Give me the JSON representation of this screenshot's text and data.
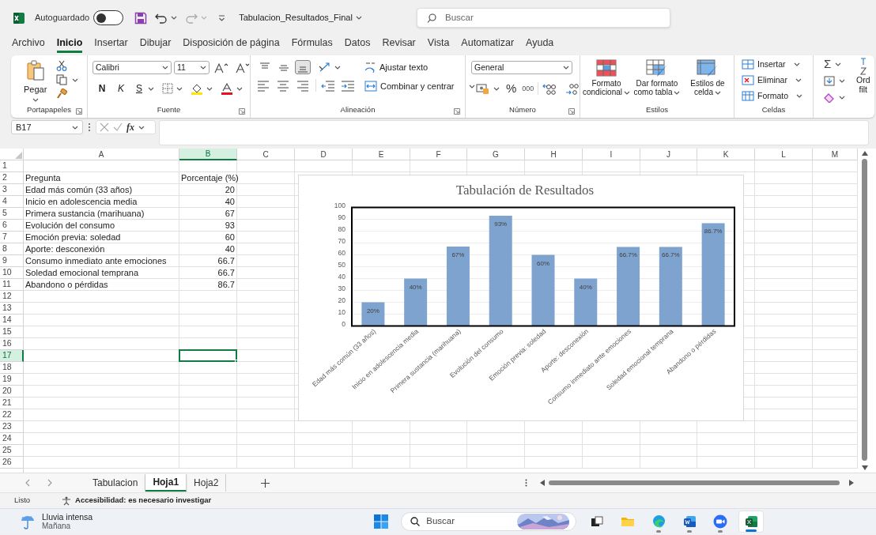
{
  "title_bar": {
    "autosave_label": "Autoguardado",
    "autosave_on": false,
    "file_name": "Tabulacion_Resultados_Final",
    "search_placeholder": "Buscar"
  },
  "menu_tabs": [
    {
      "label": "Archivo",
      "selected": false
    },
    {
      "label": "Inicio",
      "selected": true
    },
    {
      "label": "Insertar",
      "selected": false
    },
    {
      "label": "Dibujar",
      "selected": false
    },
    {
      "label": "Disposición de página",
      "selected": false
    },
    {
      "label": "Fórmulas",
      "selected": false
    },
    {
      "label": "Datos",
      "selected": false
    },
    {
      "label": "Revisar",
      "selected": false
    },
    {
      "label": "Vista",
      "selected": false
    },
    {
      "label": "Automatizar",
      "selected": false
    },
    {
      "label": "Ayuda",
      "selected": false
    }
  ],
  "ribbon": {
    "clipboard": {
      "paste_label": "Pegar",
      "group_label": "Portapapeles"
    },
    "font": {
      "font_name": "Calibri",
      "font_size": "11",
      "bold_label": "N",
      "italic_label": "K",
      "underline_label": "S",
      "group_label": "Fuente"
    },
    "alignment": {
      "vertical_align": [
        {
          "kind": "top",
          "selected": false
        },
        {
          "kind": "middle",
          "selected": false
        },
        {
          "kind": "bottom",
          "selected": true
        }
      ],
      "wrap_label": "Ajustar texto",
      "merge_label": "Combinar y centrar",
      "group_label": "Alineación"
    },
    "number": {
      "format": "General",
      "percent_label": "%",
      "thousands_label": "000",
      "group_label": "Número"
    },
    "styles": {
      "buttons": [
        {
          "kind": "conditional",
          "label": "Formato condicional"
        },
        {
          "kind": "table",
          "label": "Dar formato como tabla"
        },
        {
          "kind": "cell",
          "label": "Estilos de celda"
        }
      ],
      "group_label": "Estilos"
    },
    "cells": {
      "buttons": [
        {
          "kind": "insert",
          "label": "Insertar"
        },
        {
          "kind": "delete",
          "label": "Eliminar"
        },
        {
          "kind": "format",
          "label": "Formato"
        }
      ],
      "group_label": "Celdas"
    },
    "editing": {
      "sum_symbol": "Σ",
      "sort_label_lines": [
        "Ord",
        "filt"
      ]
    }
  },
  "formula_bar": {
    "name_box": "B17",
    "function_label": "fx"
  },
  "sheet": {
    "columns": [
      {
        "label": "A",
        "selected": false
      },
      {
        "label": "B",
        "selected": true
      },
      {
        "label": "C",
        "selected": false
      },
      {
        "label": "D",
        "selected": false
      },
      {
        "label": "E",
        "selected": false
      },
      {
        "label": "F",
        "selected": false
      },
      {
        "label": "G",
        "selected": false
      },
      {
        "label": "H",
        "selected": false
      },
      {
        "label": "I",
        "selected": false
      },
      {
        "label": "J",
        "selected": false
      },
      {
        "label": "K",
        "selected": false
      },
      {
        "label": "L",
        "selected": false
      },
      {
        "label": "M",
        "selected": false
      }
    ],
    "rows": [
      {
        "label": "1",
        "selected": false
      },
      {
        "label": "2",
        "selected": false,
        "kind": "header",
        "a": "Pregunta",
        "b": "Porcentaje (%)"
      },
      {
        "label": "3",
        "selected": false,
        "kind": "data",
        "a": "Edad más común (33 años)",
        "b": "20"
      },
      {
        "label": "4",
        "selected": false,
        "kind": "data",
        "a": "Inicio en adolescencia media",
        "b": "40"
      },
      {
        "label": "5",
        "selected": false,
        "kind": "data",
        "a": "Primera sustancia (marihuana)",
        "b": "67"
      },
      {
        "label": "6",
        "selected": false,
        "kind": "data",
        "a": "Evolución del consumo",
        "b": "93"
      },
      {
        "label": "7",
        "selected": false,
        "kind": "data",
        "a": "Emoción previa: soledad",
        "b": "60"
      },
      {
        "label": "8",
        "selected": false,
        "kind": "data",
        "a": "Aporte: desconexión",
        "b": "40"
      },
      {
        "label": "9",
        "selected": false,
        "kind": "data",
        "a": "Consumo inmediato ante emociones",
        "b": "66.7"
      },
      {
        "label": "10",
        "selected": false,
        "kind": "data",
        "a": "Soledad emocional temprana",
        "b": "66.7"
      },
      {
        "label": "11",
        "selected": false,
        "kind": "data",
        "a": "Abandono o pérdidas",
        "b": "86.7"
      },
      {
        "label": "12",
        "selected": false
      },
      {
        "label": "13",
        "selected": false
      },
      {
        "label": "14",
        "selected": false
      },
      {
        "label": "15",
        "selected": false
      },
      {
        "label": "16",
        "selected": false
      },
      {
        "label": "17",
        "selected": true
      },
      {
        "label": "18",
        "selected": false
      },
      {
        "label": "19",
        "selected": false
      },
      {
        "label": "20",
        "selected": false
      },
      {
        "label": "21",
        "selected": false
      },
      {
        "label": "22",
        "selected": false
      },
      {
        "label": "23",
        "selected": false
      },
      {
        "label": "24",
        "selected": false
      },
      {
        "label": "25",
        "selected": false
      },
      {
        "label": "26",
        "selected": false
      }
    ],
    "chart_data": {
      "type": "bar",
      "title": "Tabulación de Resultados",
      "categories": [
        "Edad más común (33 años)",
        "Inicio en adolescencia media",
        "Primera sustancia (marihuana)",
        "Evolución del consumo",
        "Emoción previa: soledad",
        "Aporte: desconexión",
        "Consumo inmediato ante emociones",
        "Soledad emocional temprana",
        "Abandono o pérdidas"
      ],
      "values": [
        20,
        40,
        67,
        93,
        60,
        40,
        66.7,
        66.7,
        86.7
      ],
      "value_labels": [
        "20%",
        "40%",
        "67%",
        "93%",
        "60%",
        "40%",
        "66.7%",
        "66.7%",
        "86.7%"
      ],
      "grid": true,
      "ylim": [
        0,
        100
      ],
      "yticks": [
        0,
        10,
        20,
        30,
        40,
        50,
        60,
        70,
        80,
        90,
        100
      ]
    }
  },
  "sheet_tabs": [
    {
      "label": "Tabulacion",
      "selected": false
    },
    {
      "label": "Hoja1",
      "selected": true
    },
    {
      "label": "Hoja2",
      "selected": false
    }
  ],
  "status_bar": {
    "ready": "Listo",
    "accessibility": "Accesibilidad: es necesario investigar"
  },
  "taskbar": {
    "weather_title": "Lluvia intensa",
    "weather_subtitle": "Mañana",
    "search_placeholder": "Buscar",
    "apps": [
      {
        "kind": "task-view",
        "running": false,
        "selected": false
      },
      {
        "kind": "folder",
        "running": false,
        "selected": false
      },
      {
        "kind": "edge",
        "running": true,
        "selected": false
      },
      {
        "kind": "word",
        "running": true,
        "selected": false
      },
      {
        "kind": "zoom",
        "running": true,
        "selected": false
      },
      {
        "kind": "excel",
        "running": true,
        "selected": true
      }
    ]
  }
}
